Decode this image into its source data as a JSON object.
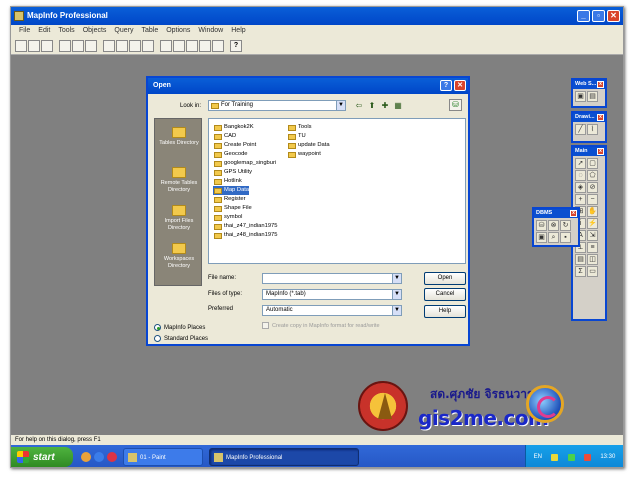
{
  "app": {
    "title": "MapInfo Professional",
    "menu": [
      "File",
      "Edit",
      "Tools",
      "Objects",
      "Query",
      "Table",
      "Options",
      "Window",
      "Help"
    ],
    "status": "For help on this dialog, press F1"
  },
  "dialog": {
    "title": "Open",
    "lookin_label": "Look in:",
    "lookin_value": "For Training",
    "places": [
      "Tables Directory",
      "Remote Tables Directory",
      "Import Files Directory",
      "Workspaces Directory"
    ],
    "files_col1": [
      "Bangkok2K",
      "CAD",
      "Create Point",
      "Geocode",
      "googlemap_singburi",
      "GPS Utility",
      "Hotlink",
      "Map Data",
      "Register",
      "Shape File",
      "symbol",
      "thai_z47_indian1975",
      "thai_z48_indian1975"
    ],
    "files_col2": [
      "Tools",
      "TU",
      "update Data",
      "waypoint"
    ],
    "selected": "Map Data",
    "filename_label": "File name:",
    "filename_value": "",
    "filetype_label": "Files of type:",
    "filetype_value": "MapInfo (*.tab)",
    "preferred_label": "Preferred",
    "preferred_value": "Automatic",
    "checkbox_label": "Create copy in MapInfo format for read/write",
    "buttons": {
      "open": "Open",
      "cancel": "Cancel",
      "help": "Help"
    },
    "radios": {
      "places": "MapInfo Places",
      "standard": "Standard Places"
    }
  },
  "palettes": {
    "webs": "Web S...",
    "drawing": "Drawi...",
    "main": "Main",
    "dbms": "DBMS"
  },
  "taskbar": {
    "start": "start",
    "tasks": [
      "01 - Paint",
      "MapInfo Professional"
    ],
    "lang": "EN",
    "time": "13:30"
  },
  "logo": {
    "thai_name": "สด.ศุภชัย จิรธนวารุล",
    "site": "gis2me.com"
  }
}
